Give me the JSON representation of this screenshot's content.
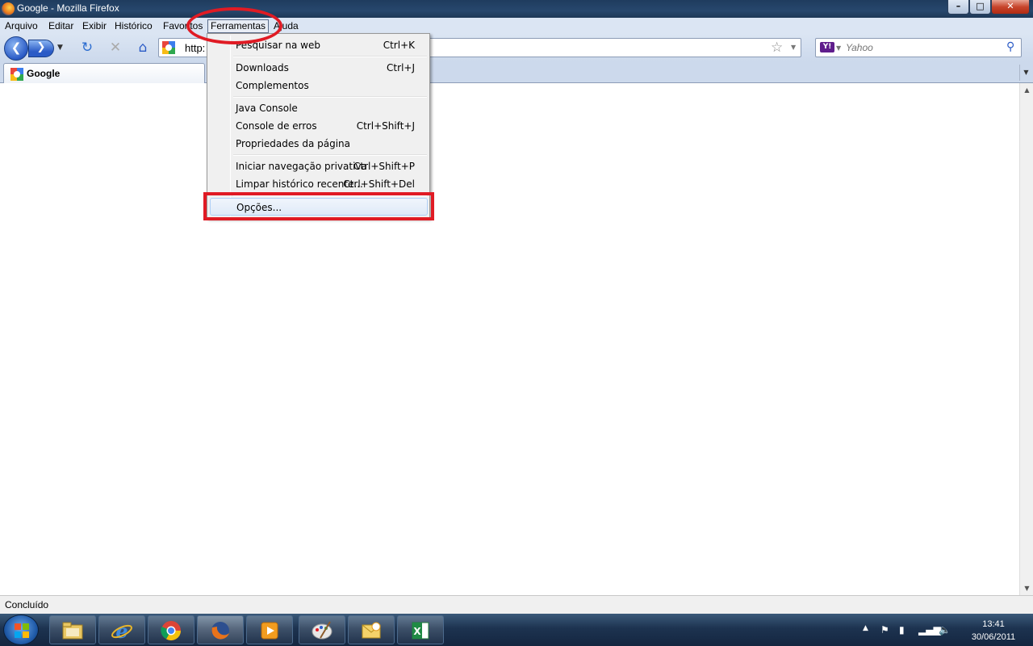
{
  "window": {
    "title": "Google - Mozilla Firefox",
    "minimize": "–",
    "maximize": "□",
    "close": "✕"
  },
  "menubar": {
    "items": [
      {
        "label": "Arquivo"
      },
      {
        "label": "Editar"
      },
      {
        "label": "Exibir"
      },
      {
        "label": "Histórico"
      },
      {
        "label": "Favoritos"
      },
      {
        "label": "Ferramentas",
        "active": true
      },
      {
        "label": "Ajuda"
      }
    ]
  },
  "navbar": {
    "url": "http:",
    "search": {
      "engine": "Yahoo",
      "placeholder": "Yahoo"
    }
  },
  "tabs": [
    {
      "title": "Google"
    }
  ],
  "tools_menu": {
    "groups": [
      [
        {
          "label": "Pesquisar na web",
          "shortcut": "Ctrl+K"
        }
      ],
      [
        {
          "label": "Downloads",
          "shortcut": "Ctrl+J"
        },
        {
          "label": "Complementos",
          "shortcut": ""
        }
      ],
      [
        {
          "label": "Java Console",
          "shortcut": ""
        },
        {
          "label": "Console de erros",
          "shortcut": "Ctrl+Shift+J"
        },
        {
          "label": "Propriedades da página",
          "shortcut": ""
        }
      ],
      [
        {
          "label": "Iniciar navegação privativa",
          "shortcut": "Ctrl+Shift+P"
        },
        {
          "label": "Limpar histórico recente...",
          "shortcut": "Ctrl+Shift+Del"
        }
      ],
      [
        {
          "label": "Opções...",
          "shortcut": "",
          "highlighted": true
        }
      ]
    ]
  },
  "statusbar": {
    "text": "Concluído"
  },
  "taskbar": {
    "clock_time": "13:41",
    "clock_date": "30/06/2011",
    "apps": [
      {
        "name": "windows-explorer-icon"
      },
      {
        "name": "internet-explorer-icon"
      },
      {
        "name": "chrome-icon"
      },
      {
        "name": "firefox-icon",
        "active": true
      },
      {
        "name": "media-player-icon"
      },
      {
        "name": "paint-icon"
      },
      {
        "name": "outlook-icon"
      },
      {
        "name": "excel-icon"
      }
    ]
  },
  "colors": {
    "annotation": "#e01b24",
    "menubar_bg": "#dbe5f3",
    "taskbar_bg": "#1d3350"
  }
}
